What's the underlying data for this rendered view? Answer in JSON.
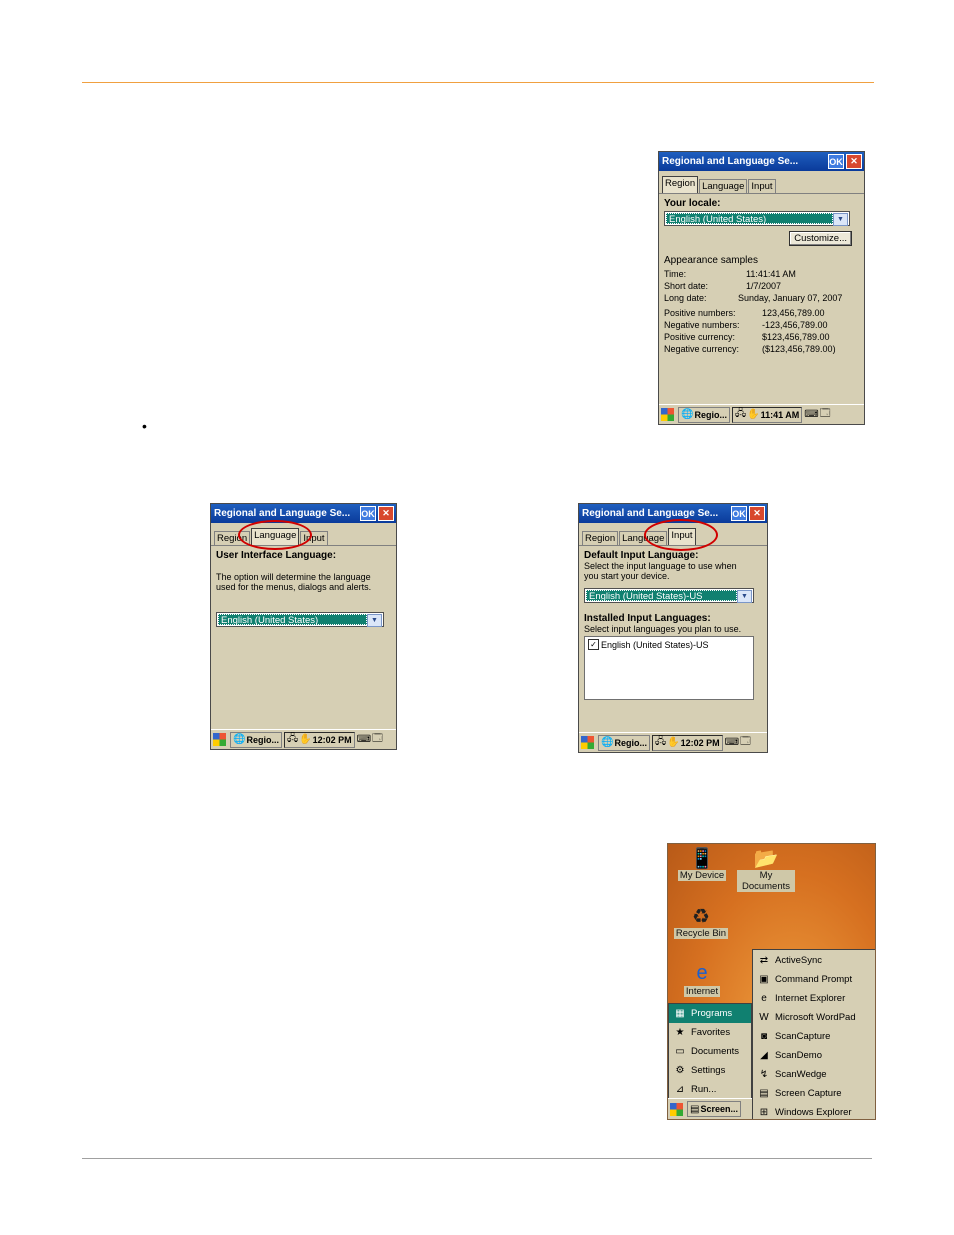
{
  "region_window": {
    "title": "Regional and Language Se...",
    "ok": "OK",
    "close": "✕",
    "tabs": [
      "Region",
      "Language",
      "Input"
    ],
    "locale_label": "Your locale:",
    "locale_value": "English (United States)",
    "customize": "Customize...",
    "samples_label": "Appearance samples",
    "samples": [
      {
        "k": "Time:",
        "v": "11:41:41 AM"
      },
      {
        "k": "Short date:",
        "v": "1/7/2007"
      },
      {
        "k": "Long date:",
        "v": "Sunday, January 07, 2007"
      }
    ],
    "numbers": [
      {
        "k": "Positive numbers:",
        "v": "123,456,789.00"
      },
      {
        "k": "Negative numbers:",
        "v": "-123,456,789.00"
      },
      {
        "k": "Positive currency:",
        "v": "$123,456,789.00"
      },
      {
        "k": "Negative currency:",
        "v": "($123,456,789.00)"
      }
    ],
    "task": "Regio...",
    "clock": "11:41 AM"
  },
  "language_window": {
    "title": "Regional and Language Se...",
    "ok": "OK",
    "close": "✕",
    "tabs": [
      "Region",
      "Language",
      "Input"
    ],
    "ui_label": "User Interface Language:",
    "desc": "The option will determine the language used for the menus, dialogs and alerts.",
    "value": "English (United States)",
    "task": "Regio...",
    "clock": "12:02 PM"
  },
  "input_window": {
    "title": "Regional and Language Se...",
    "ok": "OK",
    "close": "✕",
    "tabs": [
      "Region",
      "Language",
      "Input"
    ],
    "default_label": "Default Input Language:",
    "default_desc": "Select the input language to use when you start your device.",
    "default_value": "English (United States)-US",
    "installed_label": "Installed Input Languages:",
    "installed_desc": "Select input languages you plan to use.",
    "installed_item": "English (United States)-US",
    "task": "Regio...",
    "clock": "12:02 PM"
  },
  "desktop": {
    "icons": [
      "My Device",
      "My Documents",
      "Recycle Bin",
      "Internet"
    ],
    "start_menu": [
      "Programs",
      "Favorites",
      "Documents",
      "Settings",
      "Run..."
    ],
    "programs": [
      "ActiveSync",
      "Command Prompt",
      "Internet Explorer",
      "Microsoft WordPad",
      "ScanCapture",
      "ScanDemo",
      "ScanWedge",
      "Screen Capture",
      "Windows Explorer"
    ],
    "task": "Screen..."
  },
  "bullet": "•"
}
